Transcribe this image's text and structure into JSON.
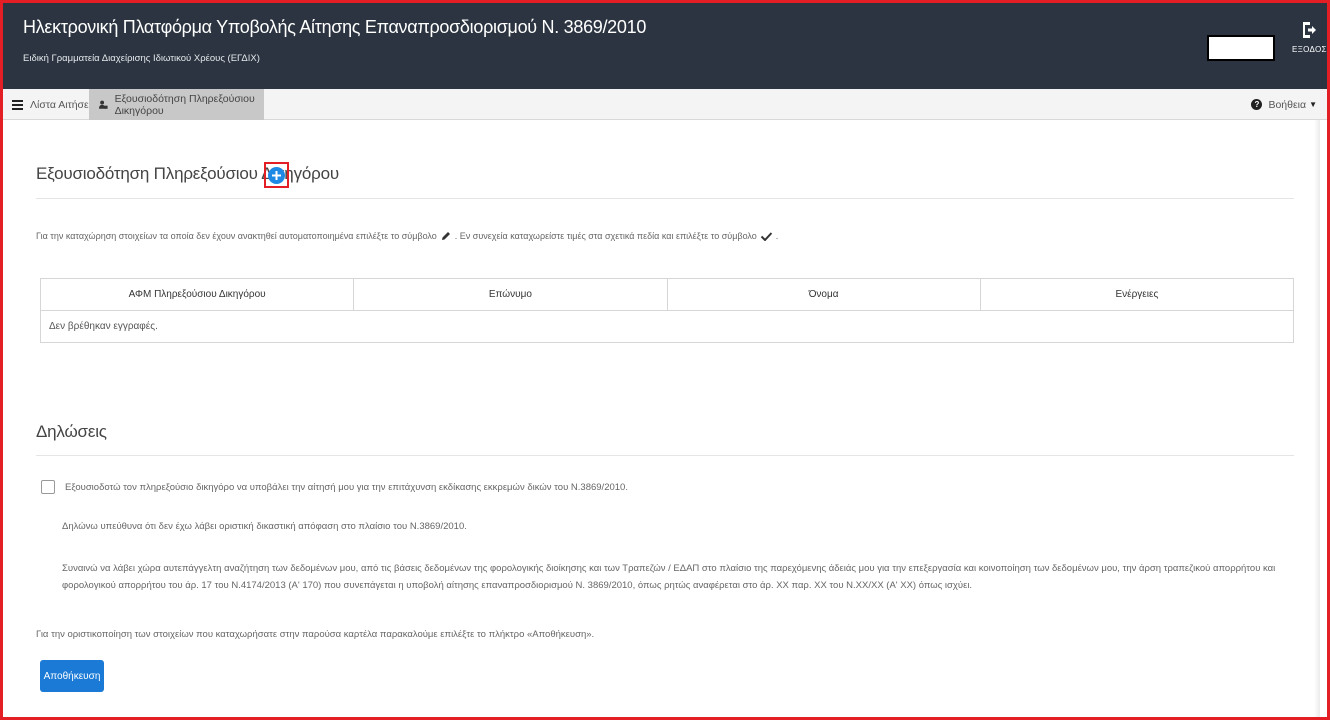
{
  "header": {
    "title": "Ηλεκτρονική Πλατφόρμα Υποβολής Αίτησης Επαναπροσδιορισμού Ν. 3869/2010",
    "subtitle": "Ειδική Γραμματεία Διαχείρισης Ιδιωτικού Χρέους (ΕΓΔΙΧ)",
    "exit_label": "ΕΞΟΔΟΣ"
  },
  "tabs": {
    "list_label": "Λίστα Αιτήσεων",
    "active_label": "Εξουσιοδότηση Πληρεξούσιου Δικηγόρου",
    "help_label": "Βοήθεια"
  },
  "authorization": {
    "title": "Εξουσιοδότηση Πληρεξούσιου Δικηγόρου",
    "instruction_part1": "Για την καταχώρηση στοιχείων τα οποία δεν έχουν ανακτηθεί αυτοματοποιημένα επιλέξτε το σύμβολο",
    "instruction_part2": ". Εν συνεχεία καταχωρείστε τιμές στα σχετικά πεδία και επιλέξτε το σύμβολο",
    "instruction_part3": ".",
    "table": {
      "columns": [
        "ΑΦΜ Πληρεξούσιου Δικηγόρου",
        "Επώνυμο",
        "Όνομα",
        "Ενέργειες"
      ],
      "empty_text": "Δεν βρέθηκαν εγγραφές."
    }
  },
  "declarations": {
    "title": "Δηλώσεις",
    "checkbox_label": "Εξουσιοδοτώ τον πληρεξούσιο δικηγόρο να υποβάλει την αίτησή μου για την επιτάχυνση εκδίκασης εκκρεμών δικών του Ν.3869/2010.",
    "statement1": "Δηλώνω υπεύθυνα ότι δεν έχω λάβει οριστική δικαστική απόφαση στο πλαίσιο του Ν.3869/2010.",
    "statement2": "Συναινώ να λάβει χώρα αυτεπάγγελτη αναζήτηση των δεδομένων μου, από τις βάσεις δεδομένων της φορολογικής διοίκησης και των Τραπεζών / ΕΔΑΠ στο πλαίσιο της παρεχόμενης άδειάς μου για την επεξεργασία και κοινοποίηση των δεδομένων μου, την άρση τραπεζικού απορρήτου και φορολογικού απορρήτου του άρ. 17 του Ν.4174/2013 (Α' 170) που συνεπάγεται η υποβολή αίτησης επαναπροσδιορισμού Ν. 3869/2010, όπως ρητώς αναφέρεται στο άρ. ΧΧ παρ. ΧΧ του Ν.ΧΧ/ΧΧ (Α' ΧΧ) όπως ισχύει.",
    "finalize_text": "Για την οριστικοποίηση των στοιχείων που καταχωρήσατε στην παρούσα καρτέλα παρακαλούμε επιλέξτε το πλήκτρο «Αποθήκευση».",
    "save_label": "Αποθήκευση"
  },
  "colors": {
    "header_bg": "#2b3440",
    "accent_blue": "#1a7ad6",
    "highlight_red": "#e31e24"
  }
}
